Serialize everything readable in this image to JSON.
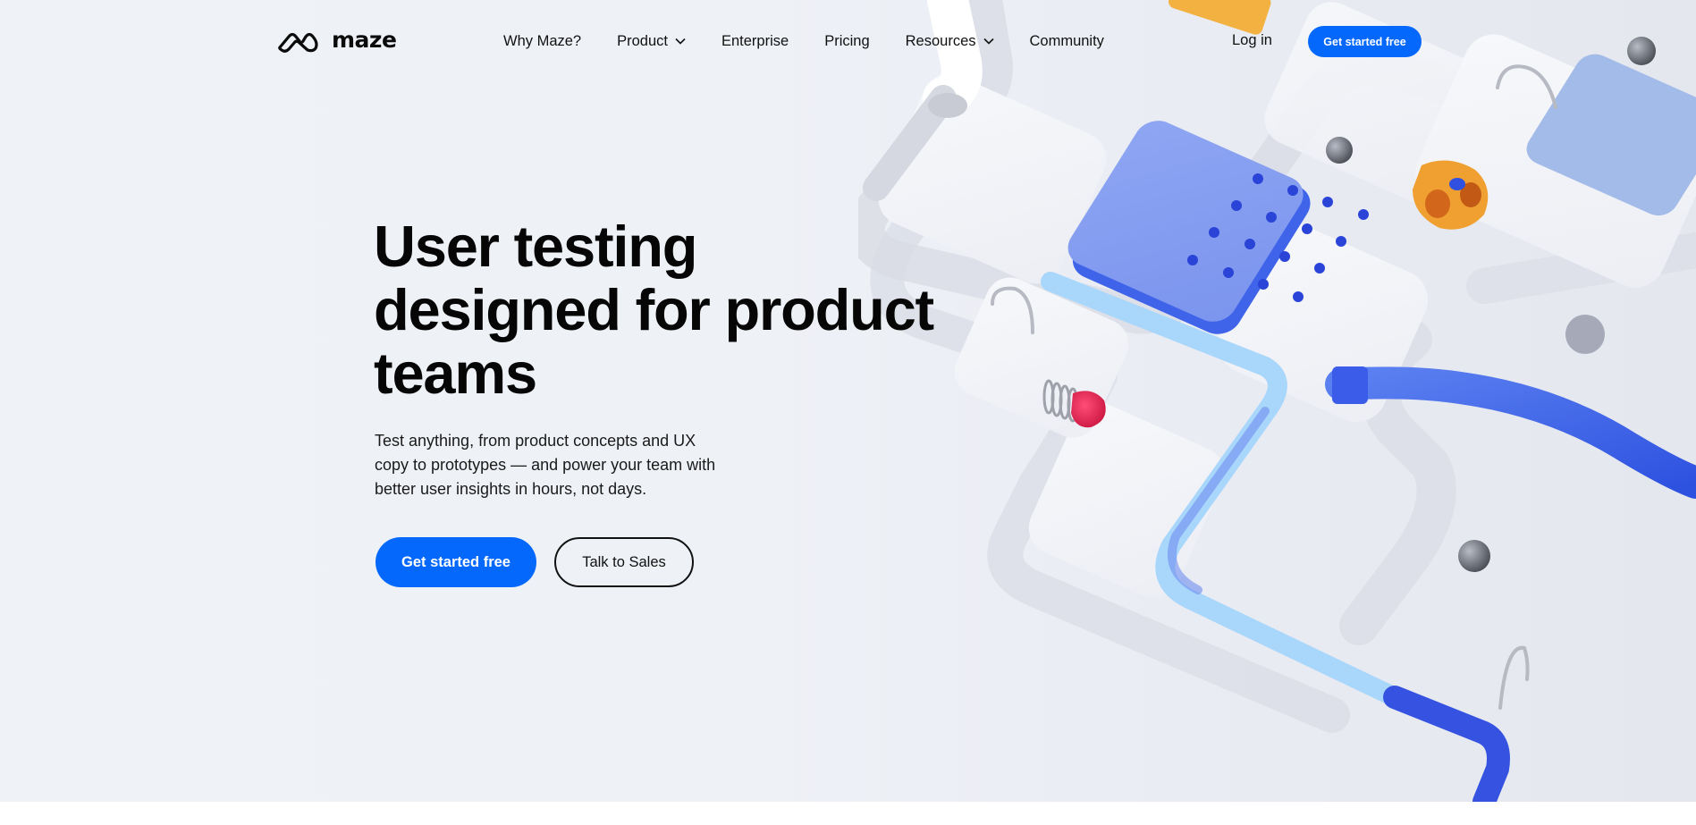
{
  "brand": {
    "name": "maze",
    "logo_icon": "maze-logo-icon",
    "accent_color": "#0568fd"
  },
  "nav": {
    "items": [
      {
        "label": "Why Maze?",
        "has_dropdown": false
      },
      {
        "label": "Product",
        "has_dropdown": true
      },
      {
        "label": "Enterprise",
        "has_dropdown": false
      },
      {
        "label": "Pricing",
        "has_dropdown": false
      },
      {
        "label": "Resources",
        "has_dropdown": true
      },
      {
        "label": "Community",
        "has_dropdown": false
      }
    ],
    "login_label": "Log in",
    "cta_label": "Get started free"
  },
  "hero": {
    "headline": "User testing\ndesigned for product\nteams",
    "subcopy": "Test anything, from product concepts and UX\ncopy to prototypes — and power your team with\nbetter user insights in hours, not days.",
    "primary_cta": "Get started free",
    "secondary_cta": "Talk to Sales",
    "illustration": "3d-marble-maze-illustration"
  }
}
